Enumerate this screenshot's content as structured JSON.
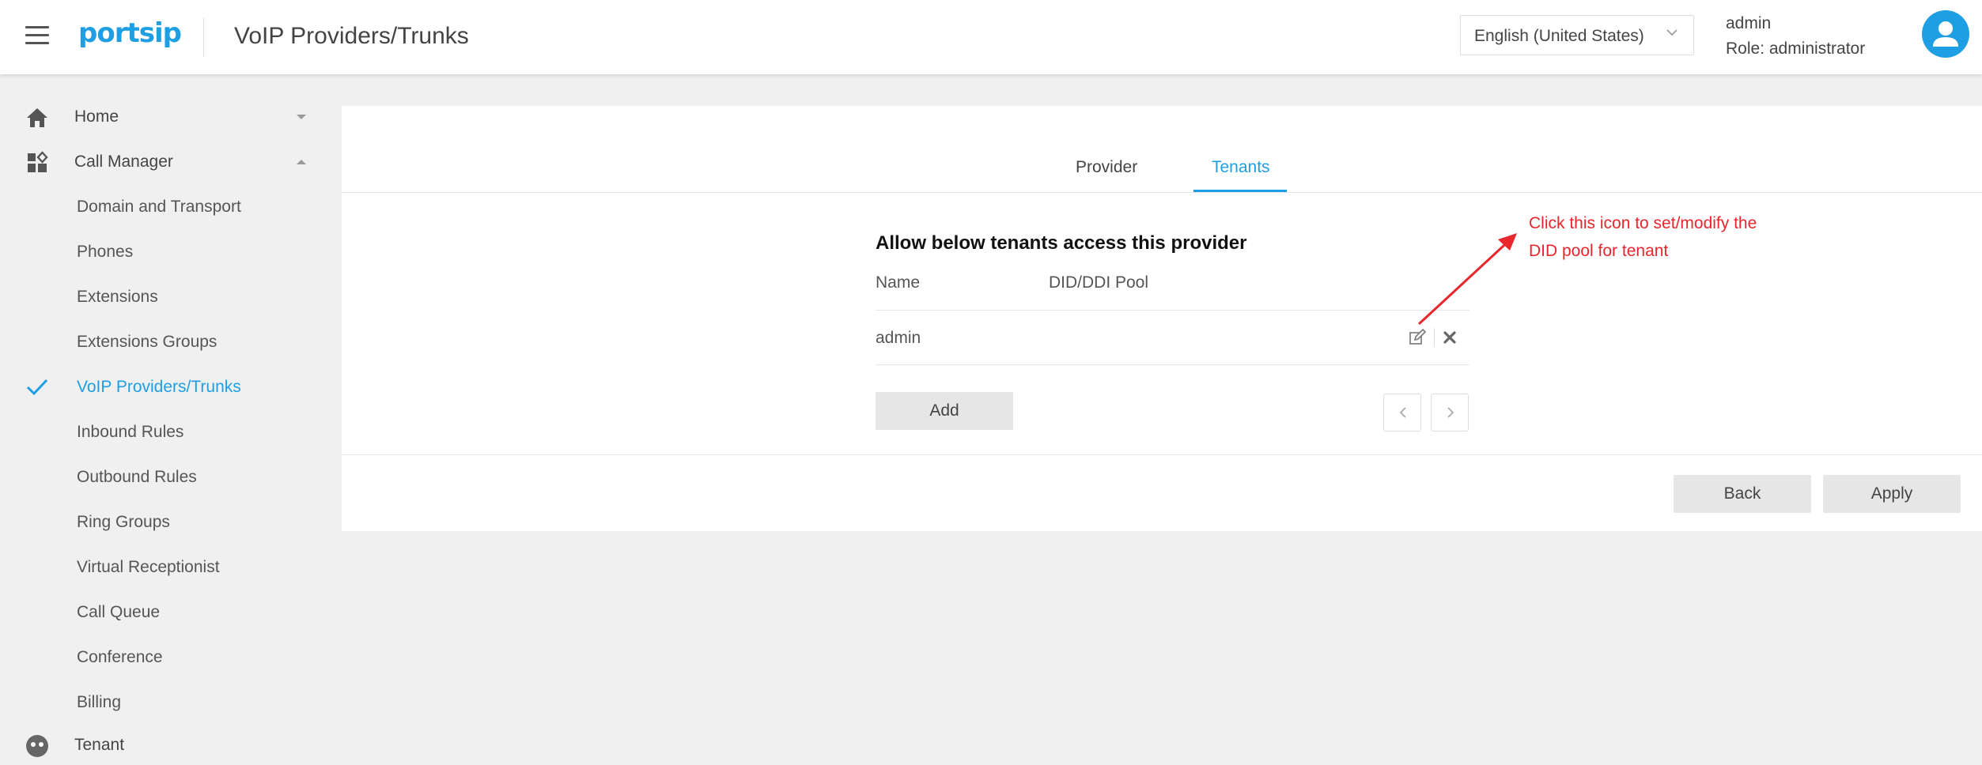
{
  "header": {
    "logo": "portsip",
    "title": "VoIP Providers/Trunks",
    "language": "English (United States)",
    "user_name": "admin",
    "user_role": "Role: administrator"
  },
  "sidebar": {
    "items": [
      {
        "label": "Home",
        "icon": "home-icon"
      },
      {
        "label": "Call Manager",
        "icon": "dashboard-icon"
      }
    ],
    "sub_items": [
      {
        "label": "Domain and Transport"
      },
      {
        "label": "Phones"
      },
      {
        "label": "Extensions"
      },
      {
        "label": "Extensions Groups"
      },
      {
        "label": "VoIP Providers/Trunks",
        "active": true
      },
      {
        "label": "Inbound Rules"
      },
      {
        "label": "Outbound Rules"
      },
      {
        "label": "Ring Groups"
      },
      {
        "label": "Virtual Receptionist"
      },
      {
        "label": "Call Queue"
      },
      {
        "label": "Conference"
      },
      {
        "label": "Billing"
      }
    ],
    "tenant": {
      "label": "Tenant",
      "icon": "tenant-icon"
    }
  },
  "main": {
    "tabs": [
      {
        "label": "Provider"
      },
      {
        "label": "Tenants",
        "active": true
      }
    ],
    "section_title": "Allow below tenants access this provider",
    "columns": [
      "Name",
      "DID/DDI Pool"
    ],
    "rows": [
      {
        "name": "admin",
        "did_pool": ""
      }
    ],
    "add_label": "Add",
    "back_label": "Back",
    "apply_label": "Apply"
  },
  "annotation": {
    "line1": "Click this icon to set/modify the",
    "line2": "DID pool for tenant"
  },
  "colors": {
    "accent": "#1e9fe4",
    "annotation": "#e8262c",
    "background": "#f0f0f0"
  }
}
